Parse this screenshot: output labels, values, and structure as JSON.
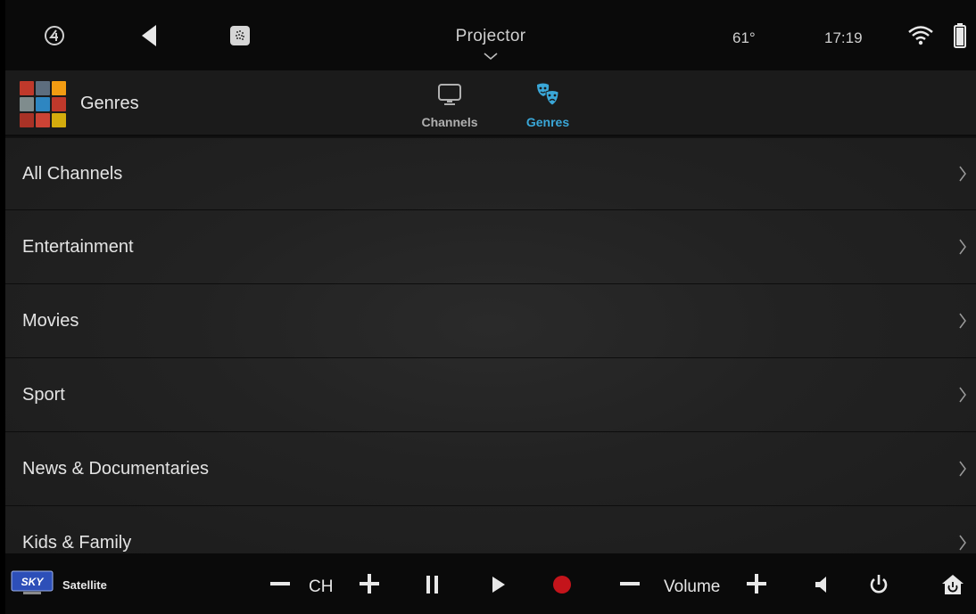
{
  "topbar": {
    "room": "Projector",
    "temperature": "61°",
    "time": "17:19",
    "icons": [
      "control4-logo-icon",
      "back-icon",
      "intercom-icon",
      "room-chevron-icon",
      "wifi-icon",
      "battery-icon"
    ]
  },
  "header": {
    "title": "Genres",
    "tabs": [
      {
        "label": "Channels",
        "icon": "tv-icon",
        "active": false
      },
      {
        "label": "Genres",
        "icon": "theater-masks-icon",
        "active": true
      }
    ]
  },
  "genres": [
    {
      "label": "All Channels"
    },
    {
      "label": "Entertainment"
    },
    {
      "label": "Movies"
    },
    {
      "label": "Sport"
    },
    {
      "label": "News & Documentaries"
    },
    {
      "label": "Kids & Family"
    }
  ],
  "controls": {
    "source_label": "Satellite",
    "channel_label": "CH",
    "volume_label": "Volume",
    "accent_color": "#3aa7d8",
    "record_color": "#c4141b"
  }
}
